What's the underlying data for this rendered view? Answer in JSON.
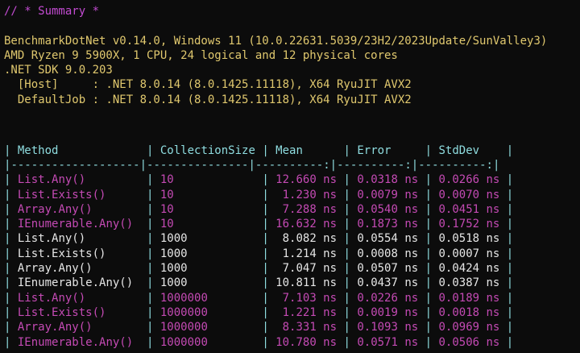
{
  "colors": {
    "background": "#0c0c0c",
    "summary": "#c24bd1",
    "info": "#e0c86e",
    "table_chrome": "#8fdde0",
    "magenta_rows": "#c44ab4",
    "white_rows": "#e6e6e6"
  },
  "summary_title": "// * Summary *",
  "info_lines": [
    "BenchmarkDotNet v0.14.0, Windows 11 (10.0.22631.5039/23H2/2023Update/SunValley3)",
    "AMD Ryzen 9 5900X, 1 CPU, 24 logical and 12 physical cores",
    ".NET SDK 9.0.203",
    "  [Host]     : .NET 8.0.14 (8.0.1425.11118), X64 RyuJIT AVX2",
    "  DefaultJob : .NET 8.0.14 (8.0.1425.11118), X64 RyuJIT AVX2"
  ],
  "table": {
    "columns": [
      {
        "label": "Method",
        "width": 18,
        "align": "left"
      },
      {
        "label": "CollectionSize",
        "width": 14,
        "align": "left"
      },
      {
        "label": "Mean",
        "width": 9,
        "align": "right"
      },
      {
        "label": "Error",
        "width": 9,
        "align": "right"
      },
      {
        "label": "StdDev",
        "width": 9,
        "align": "right"
      }
    ],
    "separator_cells": [
      "-------------------",
      "---------------",
      "----------:",
      "----------:",
      "----------:"
    ],
    "rows": [
      {
        "group": "magenta",
        "cells": [
          "List.Any()",
          "10",
          "12.660 ns",
          "0.0318 ns",
          "0.0266 ns"
        ]
      },
      {
        "group": "magenta",
        "cells": [
          "List.Exists()",
          "10",
          "1.230 ns",
          "0.0079 ns",
          "0.0070 ns"
        ]
      },
      {
        "group": "magenta",
        "cells": [
          "Array.Any()",
          "10",
          "7.288 ns",
          "0.0540 ns",
          "0.0451 ns"
        ]
      },
      {
        "group": "magenta",
        "cells": [
          "IEnumerable.Any()",
          "10",
          "16.632 ns",
          "0.1873 ns",
          "0.1752 ns"
        ]
      },
      {
        "group": "white",
        "cells": [
          "List.Any()",
          "1000",
          "8.082 ns",
          "0.0554 ns",
          "0.0518 ns"
        ]
      },
      {
        "group": "white",
        "cells": [
          "List.Exists()",
          "1000",
          "1.214 ns",
          "0.0008 ns",
          "0.0007 ns"
        ]
      },
      {
        "group": "white",
        "cells": [
          "Array.Any()",
          "1000",
          "7.047 ns",
          "0.0507 ns",
          "0.0424 ns"
        ]
      },
      {
        "group": "white",
        "cells": [
          "IEnumerable.Any()",
          "1000",
          "10.811 ns",
          "0.0437 ns",
          "0.0387 ns"
        ]
      },
      {
        "group": "magenta",
        "cells": [
          "List.Any()",
          "1000000",
          "7.103 ns",
          "0.0226 ns",
          "0.0189 ns"
        ]
      },
      {
        "group": "magenta",
        "cells": [
          "List.Exists()",
          "1000000",
          "1.221 ns",
          "0.0019 ns",
          "0.0018 ns"
        ]
      },
      {
        "group": "magenta",
        "cells": [
          "Array.Any()",
          "1000000",
          "8.331 ns",
          "0.1093 ns",
          "0.0969 ns"
        ]
      },
      {
        "group": "magenta",
        "cells": [
          "IEnumerable.Any()",
          "1000000",
          "10.780 ns",
          "0.0571 ns",
          "0.0506 ns"
        ]
      }
    ]
  }
}
